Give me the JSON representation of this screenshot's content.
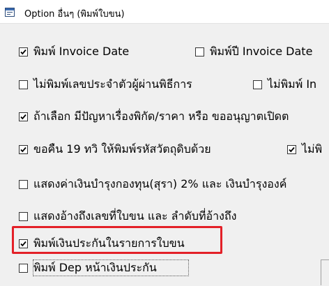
{
  "window": {
    "title": "Option อื่นๆ (พิมพ์ใบขน)",
    "icon": "window-form-icon"
  },
  "options": [
    {
      "id": "print_invoice_date",
      "label": "พิมพ์ Invoice Date",
      "checked": true
    },
    {
      "id": "print_invoice_year",
      "label": "พิมพ์ปี Invoice Date",
      "checked": false
    },
    {
      "id": "no_print_agent_id",
      "label": "ไม่พิมพ์เลขประจำตัวผู้ผ่านพิธีการ",
      "checked": false
    },
    {
      "id": "no_print_in",
      "label": "ไม่พิมพ์ In",
      "checked": false
    },
    {
      "id": "if_tariff_problem",
      "label": "ถ้าเลือก มีปัญหาเรื่องพิกัด/ราคา หรือ ขออนุญาตเปิดต",
      "checked": true
    },
    {
      "id": "refund_19",
      "label": "ขอคืน 19 ทวิ ให้พิมพ์รหัสวัตถุดิบด้วย",
      "checked": true
    },
    {
      "id": "no_print_right",
      "label": "ไม่พิ",
      "checked": true
    },
    {
      "id": "show_fund_fee",
      "label": "แสดงค่าเงินบำรุงกองทุน(สุรา) 2% และ เงินบำรุงองค์",
      "checked": false
    },
    {
      "id": "show_ref_declaration",
      "label": "แสดงอ้างถึงเลขที่ใบขน และ ลำดับที่อ้างถึง",
      "checked": false
    },
    {
      "id": "print_guarantee",
      "label": "พิมพ์เงินประกันในรายการใบขน",
      "checked": true
    },
    {
      "id": "print_dep_guarantee",
      "label": "พิมพ์ Dep หน้าเงินประกัน",
      "checked": false
    }
  ],
  "colors": {
    "highlight_border": "#e32028",
    "panel_background": "#f0f0f0"
  }
}
